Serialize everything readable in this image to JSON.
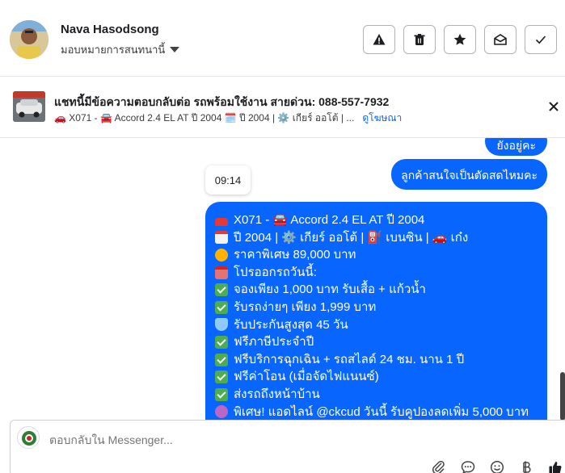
{
  "header": {
    "name": "Nava Hasodsong",
    "assign_label": "มอบหมายการสนทนานี้",
    "actions": [
      "warning-icon",
      "trash-icon",
      "star-icon",
      "mark-unread-icon",
      "check-icon"
    ]
  },
  "ad": {
    "title": "แชทนี้มีข้อความตอบกลับต่อ รถพร้อมใช้งาน สายด่วน: 088-557-7932",
    "subtitle": "🚗 X071 - 🚘 Accord 2.4 EL AT ปี 2004 🗓️ ปี 2004 | ⚙️ เกียร์ ออโต้ | ...",
    "link": "ดูโฆษณา"
  },
  "messages": {
    "partial_top": "ยังอยู่คะ",
    "ask": "ลูกค้าสนใจเป็นตัดสดไหมคะ",
    "time": "09:14",
    "offer_lines": [
      {
        "icon": "car",
        "text": "X071 - 🚘 Accord 2.4 EL AT ปี 2004"
      },
      {
        "icon": "cal",
        "text": "ปี 2004 | ⚙️ เกียร์ ออโต้ | ⛽ เบนซิน | 🚗 เก๋ง"
      },
      {
        "icon": "fire",
        "text": "ราคาพิเศษ 89,000 บาท"
      },
      {
        "icon": "gift",
        "text": "โปรออกรถวันนี้:"
      },
      {
        "icon": "check",
        "text": "จองเพียง 1,000 บาท รับเสื้อ + แก้วน้ำ"
      },
      {
        "icon": "check",
        "text": "รับรถง่ายๆ เพียง 1,999 บาท"
      },
      {
        "icon": "shield",
        "text": "รับประกันสูงสุด 45 วัน"
      },
      {
        "icon": "check",
        "text": "ฟรีภาษีประจำปี"
      },
      {
        "icon": "check",
        "text": "ฟรีบริการฉุกเฉิน + รถสไลด์ 24 ชม. นาน 1 ปี"
      },
      {
        "icon": "check",
        "text": "ฟรีค่าโอน (เมื่อจัดไฟแนนซ์)"
      },
      {
        "icon": "check",
        "text": "ส่งรถถึงหน้าบ้าน"
      },
      {
        "icon": "spark",
        "text": "พิเศษ! แอดไลน์ @ckcud วันนี้ รับคูปองลดเพิ่ม 5,000 บาท"
      }
    ]
  },
  "composer": {
    "placeholder": "ตอบกลับใน Messenger...",
    "tools": [
      "attach-icon",
      "saved-reply-icon",
      "emoji-icon",
      "baht-icon",
      "like-icon"
    ]
  }
}
